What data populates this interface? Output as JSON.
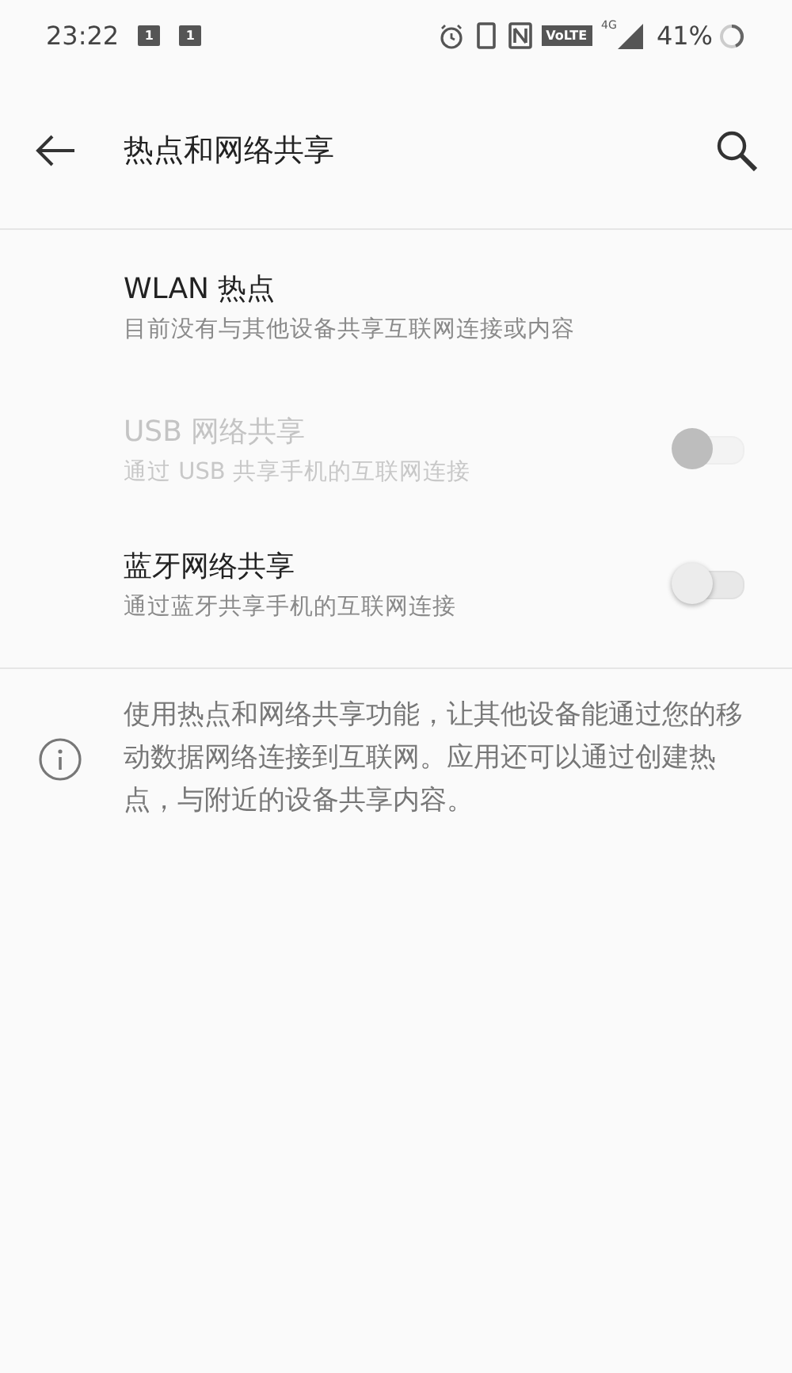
{
  "status_bar": {
    "time": "23:22",
    "notifications": [
      "1",
      "1"
    ],
    "volte": "VoLTE",
    "network": "4G",
    "battery": "41%"
  },
  "toolbar": {
    "title": "热点和网络共享"
  },
  "items": [
    {
      "kind": "plain",
      "title": "WLAN 热点",
      "subtitle": "目前没有与其他设备共享互联网连接或内容",
      "disabled": false
    },
    {
      "kind": "toggle",
      "title": "USB 网络共享",
      "subtitle": "通过 USB 共享手机的互联网连接",
      "disabled": true,
      "on": false
    },
    {
      "kind": "toggle",
      "title": "蓝牙网络共享",
      "subtitle": "通过蓝牙共享手机的互联网连接",
      "disabled": false,
      "on": false
    }
  ],
  "info": {
    "text": "使用热点和网络共享功能，让其他设备能通过您的移动数据网络连接到互联网。应用还可以通过创建热点，与附近的设备共享内容。"
  }
}
